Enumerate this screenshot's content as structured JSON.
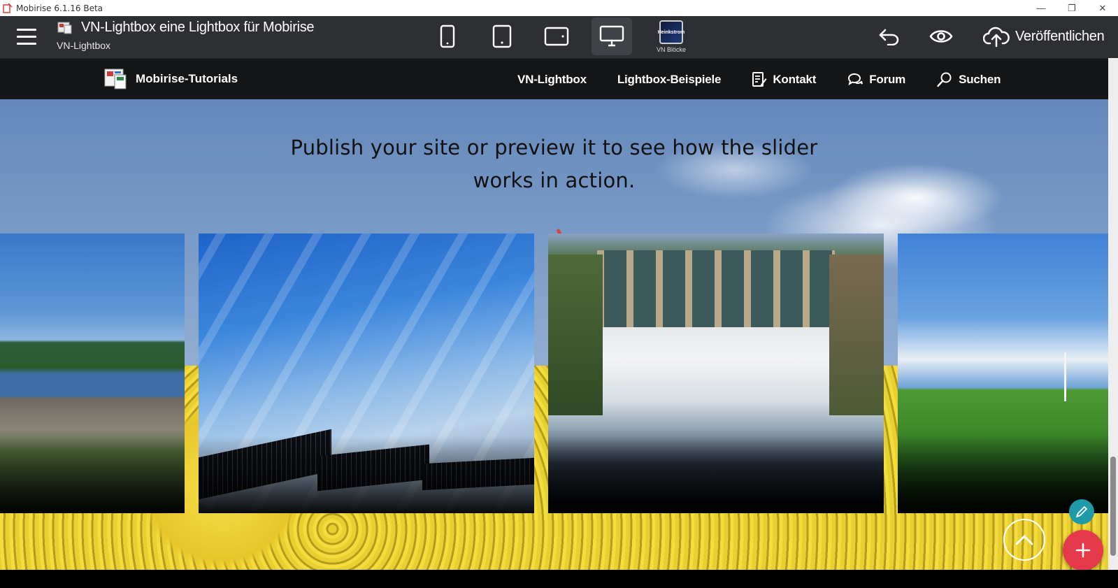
{
  "window": {
    "title": "Mobirise 6.1.16 Beta",
    "controls": [
      "minimize",
      "restore",
      "close"
    ]
  },
  "toolbar": {
    "project_title": "VN-Lightbox eine Lightbox für Mobirise",
    "project_subtitle": "VN-Lightbox",
    "devices": [
      {
        "name": "phone-portrait",
        "active": false
      },
      {
        "name": "tablet-portrait",
        "active": false
      },
      {
        "name": "tablet-landscape",
        "active": false
      },
      {
        "name": "desktop",
        "active": true
      }
    ],
    "blocks_label": "VN Blöcke",
    "blocks_thumb_text": "Heinkstrom",
    "publish_label": "Veröffentlichen"
  },
  "site_nav": {
    "brand": "Mobirise-Tutorials",
    "items": [
      {
        "label": "VN-Lightbox",
        "icon": "none"
      },
      {
        "label": "Lightbox-Beispiele",
        "icon": "none"
      },
      {
        "label": "Kontakt",
        "icon": "edit-document-icon"
      },
      {
        "label": "Forum",
        "icon": "chat-bubbles-icon"
      },
      {
        "label": "Suchen",
        "icon": "search-icon"
      }
    ]
  },
  "content": {
    "headline": "Publish your site or preview it to see how the slider works in action.",
    "slides": [
      {
        "name": "hydro-dam-lake"
      },
      {
        "name": "solar-panels-sky"
      },
      {
        "name": "dam-spillway-waterfall"
      },
      {
        "name": "wind-turbine-hills"
      }
    ]
  },
  "colors": {
    "toolbar_bg": "#2d2f33",
    "site_nav_bg": "#141517",
    "fab_add": "#e6384b",
    "fab_pen": "#1f9aa8"
  }
}
